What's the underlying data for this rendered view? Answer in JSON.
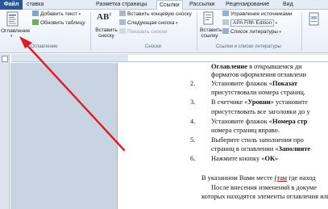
{
  "tabs": {
    "file": "Файл",
    "insert_partial": "ставка",
    "layout": "Разметка страницы",
    "references": "Ссылки",
    "mailings": "Рассылки",
    "review": "Рецензирование",
    "view": "Вид"
  },
  "ribbon": {
    "toc": {
      "button": "Оглавление",
      "add_text": "Добавить текст",
      "update_table": "Обновить таблицу",
      "group": "Оглавление"
    },
    "footnotes": {
      "insert_footnote": "Вставить сноску",
      "insert_endnote": "Вставить концевую сноску",
      "next_footnote": "Следующая сноска",
      "show_notes": "Показать сноски",
      "group": "Сноски",
      "icon_text": "AB"
    },
    "citations": {
      "insert_citation": "Вставить ссылку",
      "manage_sources": "Управление источниками",
      "style": "APA Fifth Edition",
      "bibliography": "Список литературы",
      "group": "Ссылки и списки литературы"
    }
  },
  "document": {
    "line1_bold": "Оглавление",
    "line1_rest": " в открывшемся ди",
    "line2": "форматов оформления оглавлени",
    "item2_num": "2.",
    "item2_a": "Установите флажок «",
    "item2_b": "Показат",
    "item2_line2": "присутствовали номера страниц.",
    "item3_num": "3.",
    "item3_a": "В счетчике «",
    "item3_b": "Уровни",
    "item3_c": "» установите",
    "item3_line2": "присутствовать все заголовки до у",
    "item4_num": "4.",
    "item4_a": "Установите флажок «",
    "item4_b": "Номера стр",
    "item4_line2": "номера страниц вправо.",
    "item5_num": "5.",
    "item5_a": "Выберите стиль заполнения про",
    "item5_line2a": "страниц в оглавлении «",
    "item5_line2b": "Заполните",
    "item6_num": "6.",
    "item6_a": "Нажмите кнопку «",
    "item6_b": "ОК",
    "item6_c": "»",
    "para1_a": "В указанном Вами месте ",
    "para1_u": "(там",
    "para1_b": " где наход",
    "para2": "После внесения изменений в докуме",
    "para3": "которых находятся элементы оглавления или"
  },
  "colors": {
    "arrow": "#e01b24",
    "file_tab": "#2b5797"
  }
}
